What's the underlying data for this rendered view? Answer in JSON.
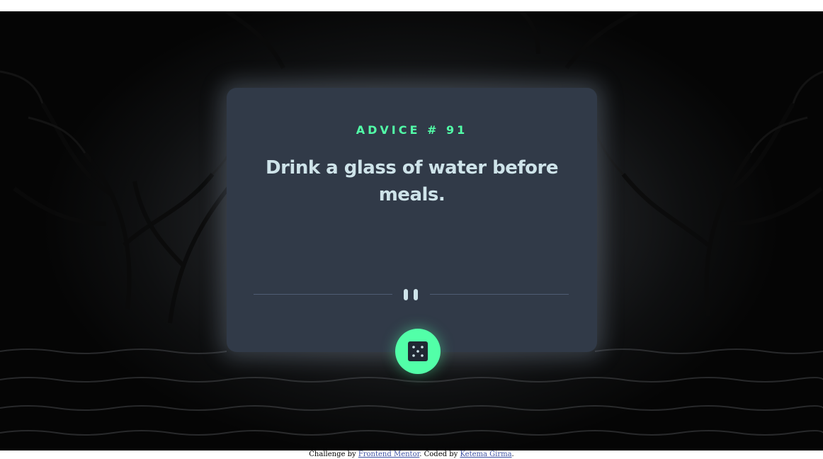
{
  "advice": {
    "label": "ADVICE # 91",
    "text": "Drink a glass of water before meals."
  },
  "controls": {
    "divider_icon": "pause-icon",
    "dice_button_icon": "dice-icon"
  },
  "attribution": {
    "prefix": "Challenge by ",
    "link1_text": "Frontend Mentor",
    "middle": ". Coded by ",
    "link2_text": "Ketema Girma",
    "suffix": "."
  },
  "colors": {
    "accent": "#52ffa8",
    "card": "#313a48",
    "text": "#cee3e9",
    "divider": "#4f5d74"
  }
}
